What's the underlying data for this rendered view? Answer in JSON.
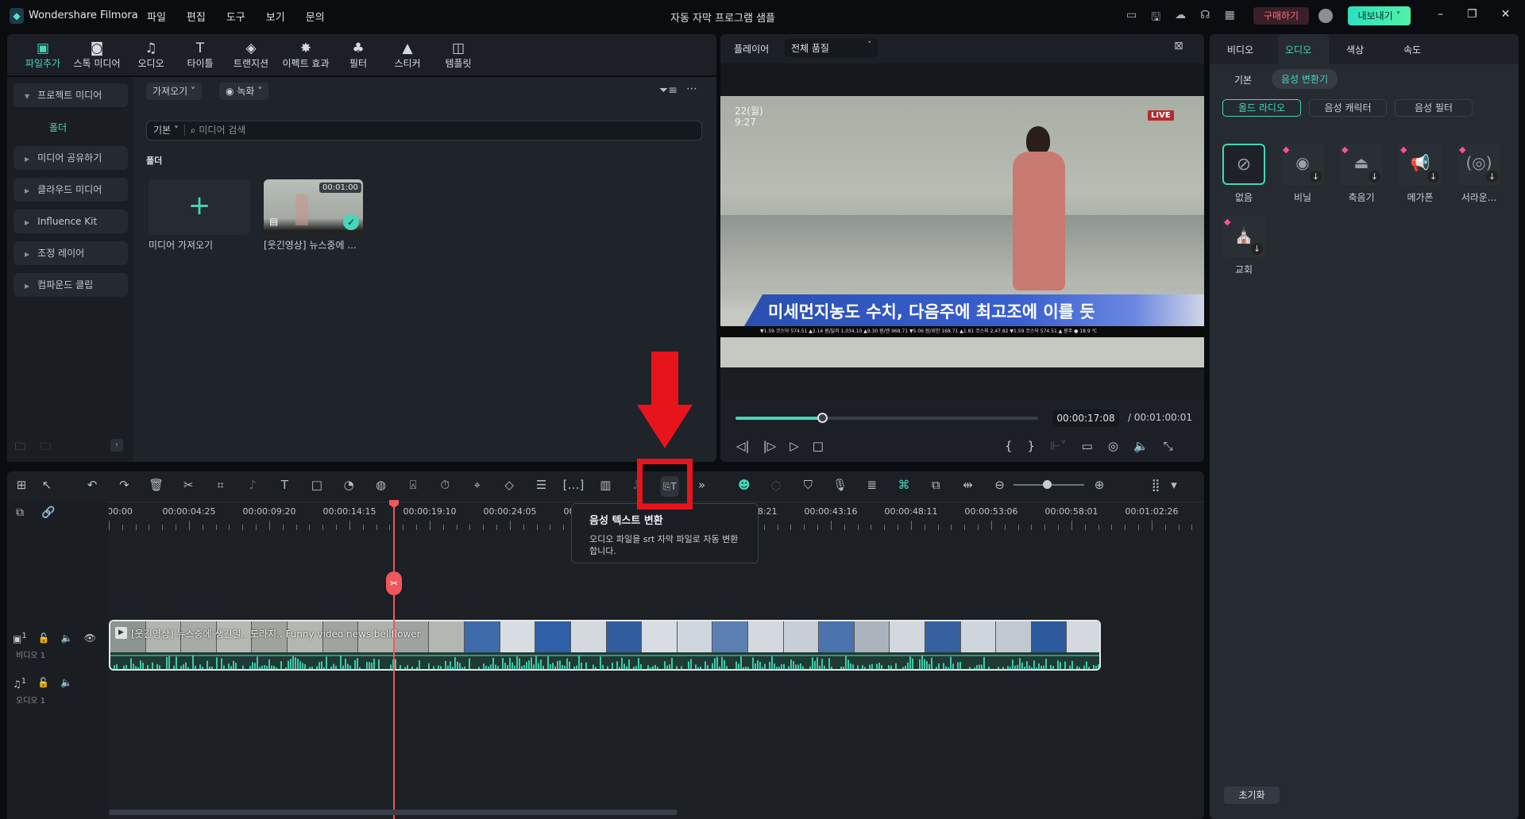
{
  "app": {
    "name": "Wondershare Filmora",
    "menu": [
      "파일",
      "편집",
      "도구",
      "보기",
      "문의"
    ],
    "doc_title": "자동 자막 프로그램 샘플",
    "buy": "구매하기",
    "export": "내보내기"
  },
  "top_tools": [
    {
      "label": "파일추가",
      "icon": "import-icon",
      "active": true
    },
    {
      "label": "스톡 미디어",
      "icon": "stock-media-icon"
    },
    {
      "label": "오디오",
      "icon": "music-note-icon"
    },
    {
      "label": "타이틀",
      "icon": "title-icon"
    },
    {
      "label": "트랜지션",
      "icon": "transition-icon"
    },
    {
      "label": "이펙트 효과",
      "icon": "effects-icon"
    },
    {
      "label": "필터",
      "icon": "filter-icon"
    },
    {
      "label": "스티커",
      "icon": "sticker-icon"
    },
    {
      "label": "템플릿",
      "icon": "template-icon"
    }
  ],
  "sidebar": {
    "items": [
      "프로젝트 미디어",
      "미디어 공유하기",
      "클라우드 미디어",
      "Influence Kit",
      "조정 레이어",
      "컴파운드 클립"
    ],
    "folder": "폴더"
  },
  "media": {
    "import_btn": "가져오기",
    "record_btn": "녹화",
    "filter_select": "기본",
    "search_placeholder": "미디어 검색",
    "section": "폴더",
    "add_label": "미디어 가져오기",
    "clip_label": "[웃긴영상] 뉴스중에 ...",
    "clip_duration": "00:01:00"
  },
  "player": {
    "label": "플레이어",
    "quality": "전체 품질",
    "date": "22(월)",
    "time": "9:27",
    "live": "LIVE",
    "caption": "미세먼지농도 수치, 다음주에 최고조에 이를 듯",
    "ticker": "▼1.59  코스닥 574.51 ▲2.14   원/달러 1,034.10 ▲9.30   원/엔 968.71 ▼5.06   원/위안 168.71 ▲1.81   코스피 2,47.82 ▼1.59   코스닥 574.51 ▲      원주 ● 18.9 ℃",
    "current": "00:00:17:08",
    "total": "/ 00:01:00:01",
    "progress": 0.285
  },
  "right": {
    "tabs": [
      "비디오",
      "오디오",
      "색상",
      "속도"
    ],
    "active_tab": 1,
    "subtabs": [
      "기본",
      "음성 변환기"
    ],
    "chips": [
      "올드 라디오",
      "음성 캐릭터",
      "음성 필터"
    ],
    "presets": [
      {
        "label": "없음",
        "icon": "none-icon"
      },
      {
        "label": "비닐",
        "icon": "vinyl-icon"
      },
      {
        "label": "축음기",
        "icon": "gramophone-icon"
      },
      {
        "label": "메가폰",
        "icon": "megaphone-icon"
      },
      {
        "label": "서라운...",
        "icon": "surround-icon"
      },
      {
        "label": "교회",
        "icon": "church-icon"
      }
    ],
    "reset": "초기화"
  },
  "timeline": {
    "ruler": [
      "00:00",
      "00:00:04:25",
      "00:00:09:20",
      "00:00:14:15",
      "00:00:19:10",
      "00:00:24:05",
      "00:00:29:00",
      "",
      "00:00:38:21",
      "00:00:43:16",
      "00:00:48:11",
      "00:00:53:06",
      "00:00:58:01",
      "00:01:02:26"
    ],
    "video_track": "비디오 1",
    "audio_track": "오디오 1",
    "track_num": "1",
    "clip_title": "[웃긴영상] 뉴스중에 생긴일.. 도라지.. Funny video news bellflower"
  },
  "tooltip": {
    "title": "음성 텍스트 변환",
    "body": "오디오 파일을 srt 자막 파일로 자동 변환합니다."
  },
  "colors": {
    "accent": "#45d7b8",
    "highlight": "#e8141c",
    "playhead": "#f0575a"
  }
}
